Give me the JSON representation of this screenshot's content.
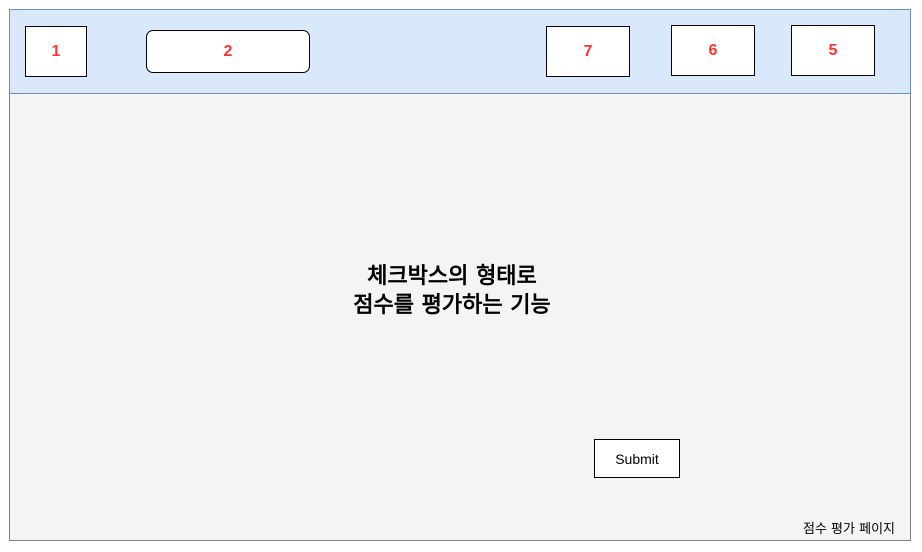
{
  "header": {
    "boxes": [
      {
        "label": "1"
      },
      {
        "label": "2"
      },
      {
        "label": "7"
      },
      {
        "label": "6"
      },
      {
        "label": "5"
      }
    ]
  },
  "main": {
    "description_line1": "체크박스의 형태로",
    "description_line2": "점수를 평가하는 기능",
    "submit_label": "Submit"
  },
  "footer": {
    "page_label": "점수 평가 페이지"
  },
  "colors": {
    "header_fill": "#dae8fc",
    "header_border": "#6c8ebf",
    "page_fill": "#f4f4f4",
    "number_text": "#ff3333"
  }
}
